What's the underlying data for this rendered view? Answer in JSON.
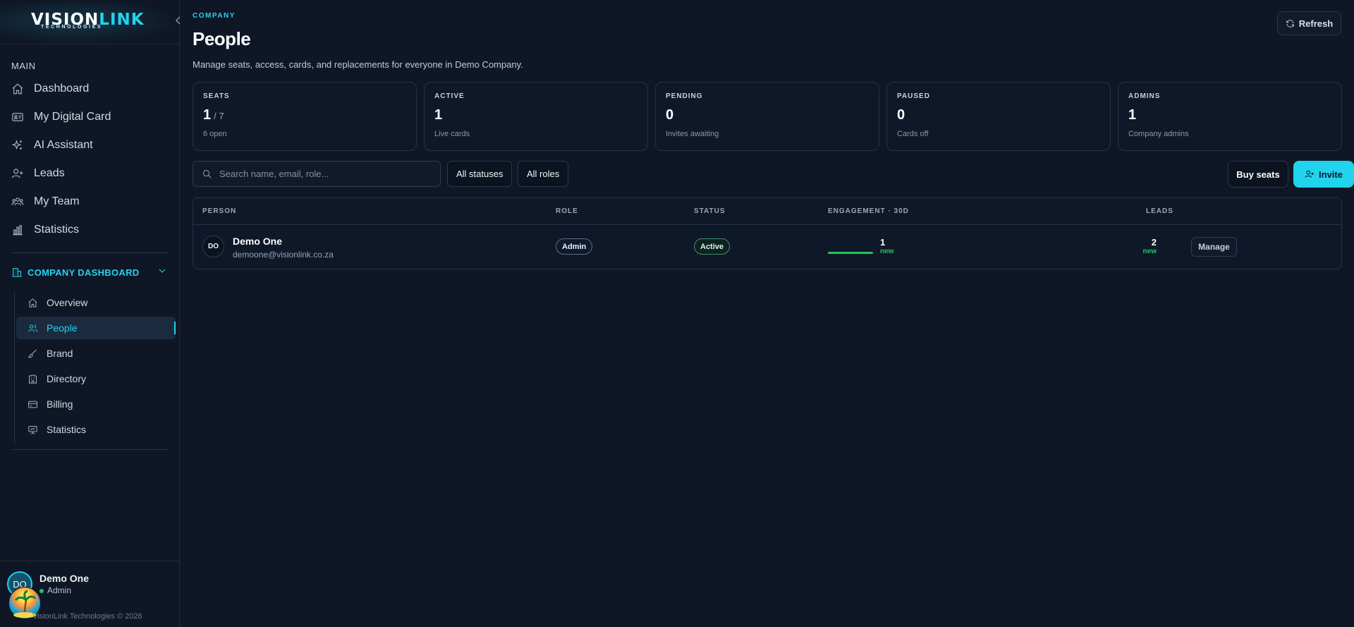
{
  "brand": {
    "logo_part1": "VISION",
    "logo_part2": "LINK",
    "logo_sub": "TECHNOLOGIES",
    "accent_color": "#22d3ee"
  },
  "sidebar": {
    "section_label": "MAIN",
    "items": [
      {
        "label": "Dashboard",
        "icon": "home-icon"
      },
      {
        "label": "My Digital Card",
        "icon": "id-card-icon"
      },
      {
        "label": "AI Assistant",
        "icon": "sparkles-icon"
      },
      {
        "label": "Leads",
        "icon": "user-plus-icon"
      },
      {
        "label": "My Team",
        "icon": "team-icon"
      },
      {
        "label": "Statistics",
        "icon": "bar-chart-icon"
      }
    ],
    "company_section": {
      "label": "COMPANY DASHBOARD",
      "items": [
        {
          "label": "Overview",
          "icon": "home-icon"
        },
        {
          "label": "People",
          "icon": "users-icon",
          "active": true
        },
        {
          "label": "Brand",
          "icon": "brush-icon"
        },
        {
          "label": "Directory",
          "icon": "building-icon"
        },
        {
          "label": "Billing",
          "icon": "credit-card-icon"
        },
        {
          "label": "Statistics",
          "icon": "presentation-icon"
        }
      ]
    },
    "user": {
      "initials": "DO",
      "name": "Demo One",
      "role": "Admin",
      "copyright": "VisionLink Technologies © 2026"
    }
  },
  "header": {
    "eyebrow": "COMPANY",
    "title": "People",
    "subtitle": "Manage seats, access, cards, and replacements for everyone in Demo Company.",
    "refresh_label": "Refresh"
  },
  "stats": [
    {
      "label": "SEATS",
      "value": "1",
      "of": "/ 7",
      "note": "6 open"
    },
    {
      "label": "ACTIVE",
      "value": "1",
      "of": "",
      "note": "Live cards"
    },
    {
      "label": "PENDING",
      "value": "0",
      "of": "",
      "note": "Invites awaiting"
    },
    {
      "label": "PAUSED",
      "value": "0",
      "of": "",
      "note": "Cards off"
    },
    {
      "label": "ADMINS",
      "value": "1",
      "of": "",
      "note": "Company admins"
    }
  ],
  "toolbar": {
    "search_placeholder": "Search name, email, role...",
    "status_filter": "All statuses",
    "role_filter": "All roles",
    "buy_seats_label": "Buy seats",
    "invite_label": "Invite"
  },
  "table": {
    "headers": {
      "person": "PERSON",
      "role": "ROLE",
      "status": "STATUS",
      "engagement": "ENGAGEMENT · 30D",
      "leads": "LEADS"
    },
    "rows": [
      {
        "initials": "DO",
        "name": "Demo One",
        "email": "demoone@visionlink.co.za",
        "role": "Admin",
        "status": "Active",
        "engagement_value": "1",
        "engagement_new": "new",
        "engagement_fill": 1.0,
        "leads_value": "2",
        "leads_new": "new",
        "action_label": "Manage"
      }
    ]
  }
}
